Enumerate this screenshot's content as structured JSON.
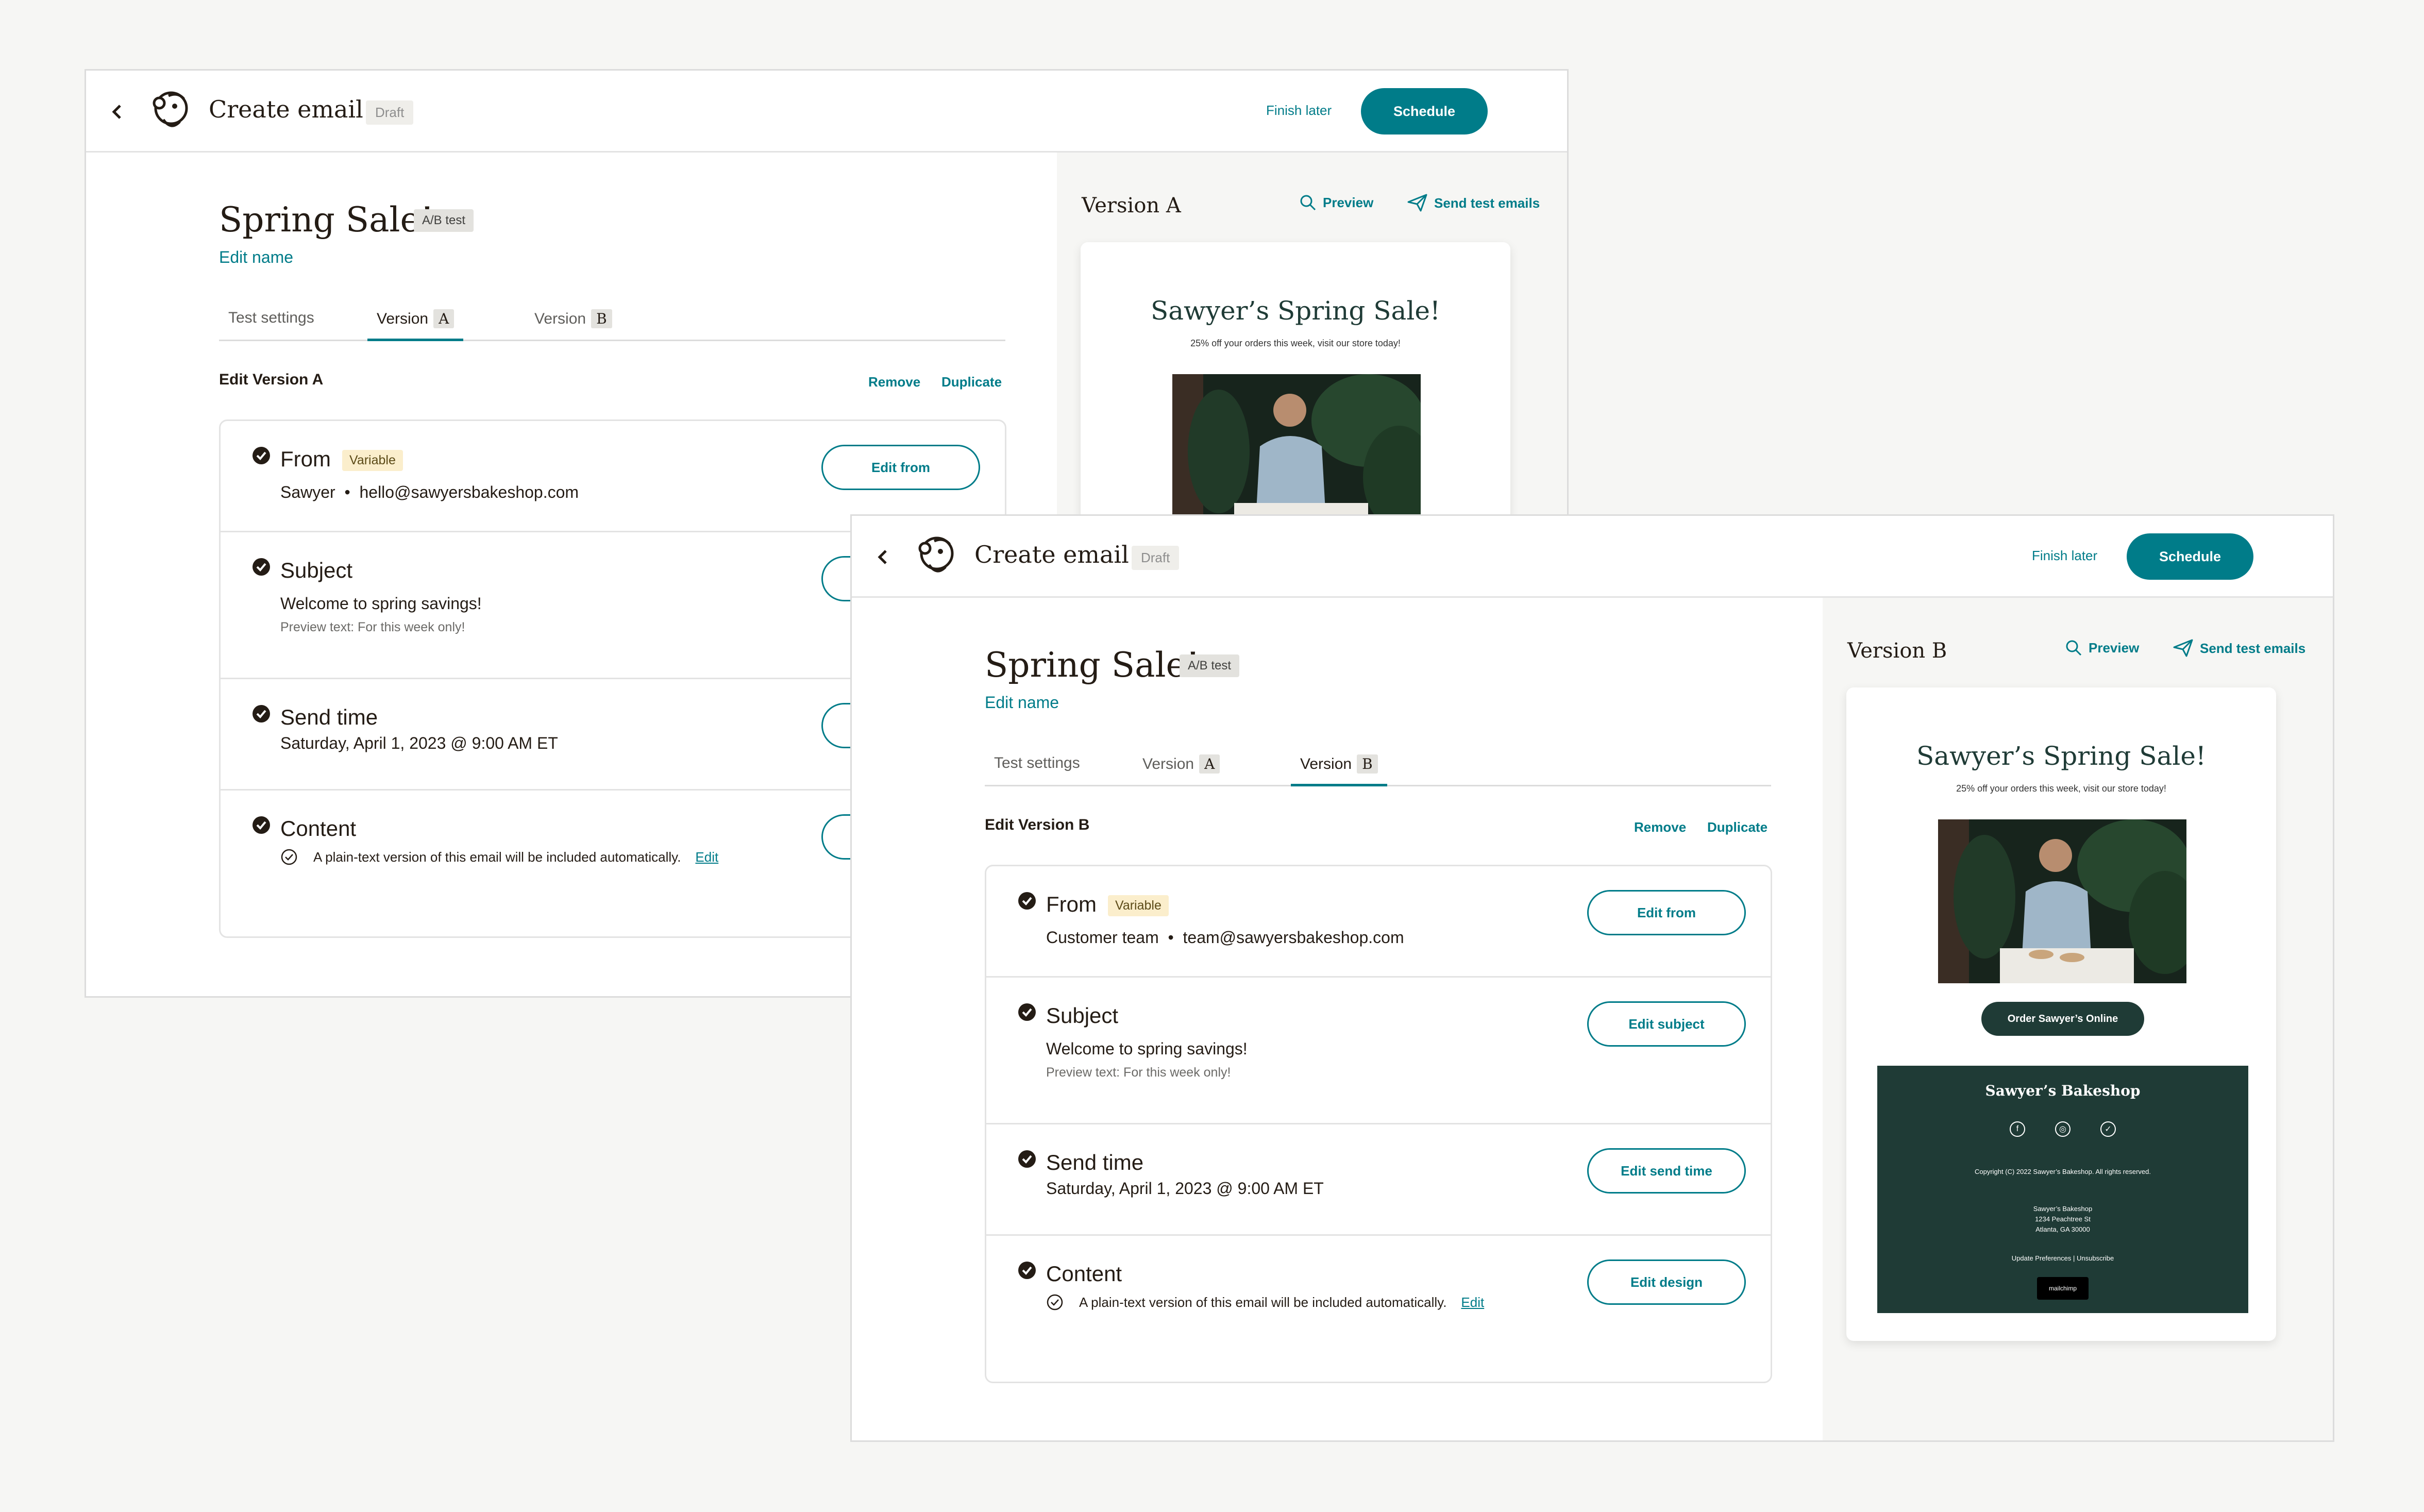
{
  "app": {
    "title": "Create email",
    "status_badge": "Draft",
    "finish_later": "Finish later",
    "schedule": "Schedule"
  },
  "campaign": {
    "name": "Spring Sale!",
    "type_badge": "A/B test",
    "edit_name": "Edit name"
  },
  "tabs": [
    {
      "label": "Test settings"
    },
    {
      "label": "Version",
      "letter": "A"
    },
    {
      "label": "Version",
      "letter": "B"
    }
  ],
  "actions": {
    "remove": "Remove",
    "duplicate": "Duplicate"
  },
  "variable_badge": "Variable",
  "plain_text_note": "A plain-text version of this email will be included automatically.",
  "plain_text_edit": "Edit",
  "versionA": {
    "edit_label": "Edit Version A",
    "from": {
      "title": "From",
      "name": "Sawyer",
      "email": "hello@sawyersbakeshop.com",
      "button": "Edit from"
    },
    "subject": {
      "title": "Subject",
      "line": "Welcome to spring savings!",
      "preview": "Preview text: For this week only!"
    },
    "send_time": {
      "title": "Send time",
      "value": "Saturday, April 1, 2023 @ 9:00 AM ET"
    },
    "content": {
      "title": "Content"
    },
    "panel_title": "Version A"
  },
  "versionB": {
    "edit_label": "Edit Version B",
    "from": {
      "title": "From",
      "name": "Customer team",
      "email": "team@sawyersbakeshop.com",
      "button": "Edit from"
    },
    "subject": {
      "title": "Subject",
      "line": "Welcome to spring savings!",
      "preview": "Preview text: For this week only!",
      "button": "Edit subject"
    },
    "send_time": {
      "title": "Send time",
      "value": "Saturday, April 1, 2023 @ 9:00 AM ET",
      "button": "Edit send time"
    },
    "content": {
      "title": "Content",
      "button": "Edit design"
    },
    "panel_title": "Version B"
  },
  "panel": {
    "preview": "Preview",
    "send_test": "Send test emails"
  },
  "email": {
    "headline": "Sawyer’s Spring Sale!",
    "subline": "25% off your orders this week, visit our store today!",
    "cta": "Order Sawyer’s Online",
    "footer_brand": "Sawyer’s Bakeshop",
    "social_icons": [
      "facebook-icon",
      "instagram-icon",
      "twitter-icon"
    ],
    "copyright": "Copyright (C) 2022 Sawyer’s Bakeshop. All rights reserved.",
    "address": [
      "Sawyer’s Bakeshop",
      "1234 Peachtree St",
      "Atlanta, GA 30000"
    ],
    "footer_links": "Update Preferences | Unsubscribe",
    "mailchimp_badge": "mailchimp"
  },
  "colors": {
    "accent": "#007c89",
    "email_dark": "#1f3b36",
    "variable_bg": "#fbeecc"
  }
}
